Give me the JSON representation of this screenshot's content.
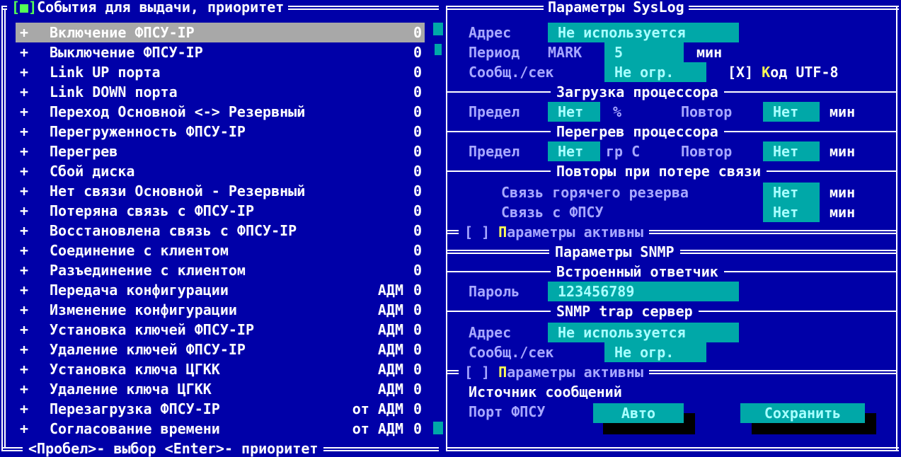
{
  "left_panel": {
    "title_marker": "[■]",
    "title": "События для выдачи, приоритет",
    "footer": "<Пробел>- выбор <Enter>- приоритет",
    "events": [
      {
        "mark": "+",
        "label": "Включение ФПСУ-IP",
        "tag": "",
        "count": "0",
        "selected": true
      },
      {
        "mark": "+",
        "label": "Выключение ФПСУ-IP",
        "tag": "",
        "count": "0"
      },
      {
        "mark": "+",
        "label": "Link UP порта",
        "tag": "",
        "count": "0"
      },
      {
        "mark": "+",
        "label": "Link DOWN порта",
        "tag": "",
        "count": "0"
      },
      {
        "mark": "+",
        "label": "Переход Основной <-> Резервный",
        "tag": "",
        "count": "0"
      },
      {
        "mark": "+",
        "label": "Перегруженность ФПСУ-IP",
        "tag": "",
        "count": "0"
      },
      {
        "mark": "+",
        "label": "Перегрев",
        "tag": "",
        "count": "0"
      },
      {
        "mark": "+",
        "label": "Сбой диска",
        "tag": "",
        "count": "0"
      },
      {
        "mark": "+",
        "label": "Нет связи Основной - Резервный",
        "tag": "",
        "count": "0"
      },
      {
        "mark": "+",
        "label": "Потеряна связь с ФПСУ-IP",
        "tag": "",
        "count": "0"
      },
      {
        "mark": "+",
        "label": "Восстановлена связь с ФПСУ-IP",
        "tag": "",
        "count": "0"
      },
      {
        "mark": "+",
        "label": "Соединение с клиентом",
        "tag": "",
        "count": "0"
      },
      {
        "mark": "+",
        "label": "Разъединение с клиентом",
        "tag": "",
        "count": "0"
      },
      {
        "mark": "+",
        "label": "Передача конфигурации",
        "tag": "АДМ",
        "count": "0"
      },
      {
        "mark": "+",
        "label": "Изменение конфигурации",
        "tag": "АДМ",
        "count": "0"
      },
      {
        "mark": "+",
        "label": "Установка ключей ФПСУ-IP",
        "tag": "АДМ",
        "count": "0"
      },
      {
        "mark": "+",
        "label": "Удаление ключей ФПСУ-IP",
        "tag": "АДМ",
        "count": "0"
      },
      {
        "mark": "+",
        "label": "Установка ключа ЦГКК",
        "tag": "АДМ",
        "count": "0"
      },
      {
        "mark": "+",
        "label": "Удаление ключа ЦГКК",
        "tag": "АДМ",
        "count": "0"
      },
      {
        "mark": "+",
        "label": "Перезагрузка ФПСУ-IP",
        "tag": "от АДМ",
        "count": "0"
      },
      {
        "mark": "+",
        "label": "Согласование времени",
        "tag": "от АДМ",
        "count": "0"
      }
    ]
  },
  "syslog": {
    "title": "Параметры SysLog",
    "address_label": "Адрес",
    "address_value": "Не используется",
    "period_label": "Период",
    "mark_label": "MARK",
    "period_value": "5",
    "period_unit": "мин",
    "rate_label": "Сообщ./сек",
    "rate_value": "Не огр.",
    "utf8_check": "[X]",
    "utf8_hot": "К",
    "utf8_rest": "од UTF-8",
    "cpu_load_title": "Загрузка процессора",
    "cpu_limit_label": "Предел",
    "cpu_limit_value": "Нет",
    "cpu_limit_unit": "%",
    "cpu_repeat_label": "Повтор",
    "cpu_repeat_value": "Нет",
    "cpu_repeat_unit": "мин",
    "overheat_title": "Перегрев процессора",
    "heat_limit_label": "Предел",
    "heat_limit_value": "Нет",
    "heat_limit_unit": "гр С",
    "heat_repeat_label": "Повтор",
    "heat_repeat_value": "Нет",
    "heat_repeat_unit": "мин",
    "loss_title": "Повторы при потере связи",
    "hot_reserve_label": "Связь горячего резерва",
    "hot_reserve_value": "Нет",
    "hot_reserve_unit": "мин",
    "fpsu_link_label": "Связь с ФПСУ",
    "fpsu_link_value": "Нет",
    "fpsu_link_unit": "мин",
    "active_check": "[ ]",
    "active_hot": "П",
    "active_rest": "араметры активны"
  },
  "snmp": {
    "title": "Параметры SNMP",
    "agent_title": "Встроенный ответчик",
    "password_label": "Пароль",
    "password_value": "123456789",
    "trap_title": "SNMP trap сервер",
    "address_label": "Адрес",
    "address_value": "Не используется",
    "rate_label": "Сообщ./сек",
    "rate_value": "Не огр.",
    "active_check": "[ ]",
    "active_hot": "П",
    "active_rest": "араметры активны"
  },
  "source": {
    "title": "Источник сообщений",
    "port_label": "Порт ФПСУ",
    "port_value": "Авто",
    "save_label": "Сохранить"
  }
}
